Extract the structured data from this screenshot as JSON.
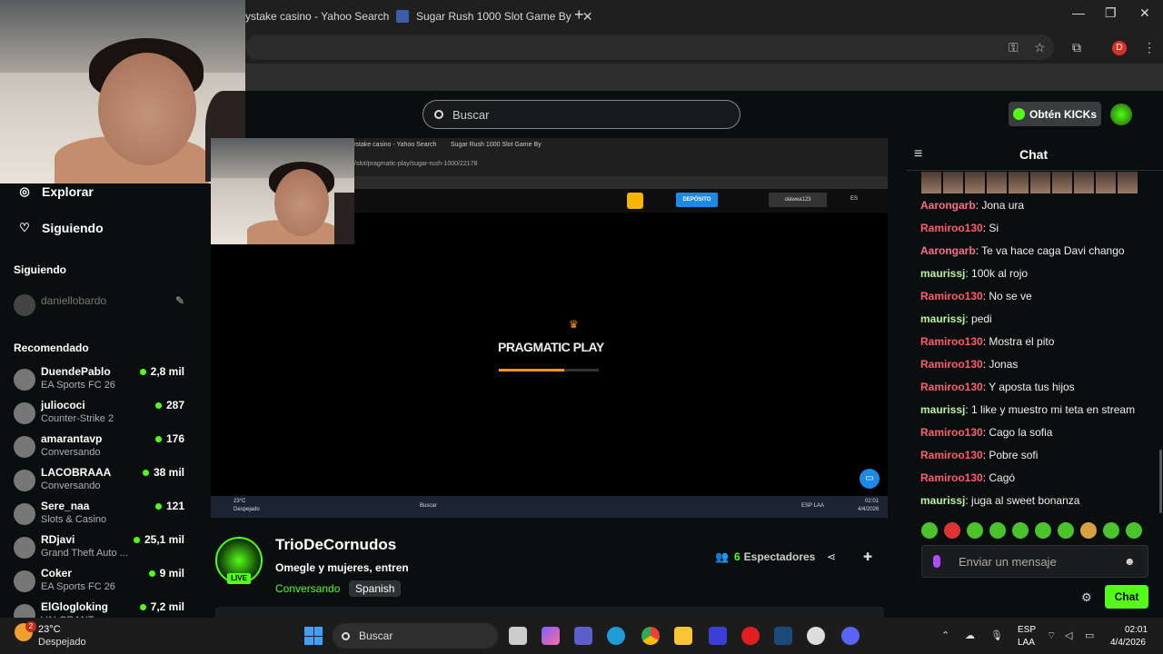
{
  "browser": {
    "tabs": [
      {
        "label": "ystake casino - Yahoo Search",
        "close": "✕"
      },
      {
        "label": "Sugar Rush 1000 Slot Game By",
        "close": "✕"
      }
    ],
    "new_tab": "+",
    "window_controls": {
      "minimize": "—",
      "maximize": "❐",
      "close": "✕"
    },
    "profile_initial": "D"
  },
  "header": {
    "search_placeholder": "Buscar",
    "get_kicks": "Obtén KICKs"
  },
  "sidebar": {
    "nav": [
      {
        "label": "Explorar",
        "icon": "compass-icon"
      },
      {
        "label": "Siguiendo",
        "icon": "heart-icon"
      }
    ],
    "following_title": "Siguiendo",
    "following": [
      {
        "name": "daniellobardo"
      }
    ],
    "recommended_title": "Recomendado",
    "recommended": [
      {
        "name": "DuendePablo",
        "category": "EA Sports FC 26",
        "viewers": "2,8 mil"
      },
      {
        "name": "juliococi",
        "category": "Counter-Strike 2",
        "viewers": "287"
      },
      {
        "name": "amarantavp",
        "category": "Conversando",
        "viewers": "176"
      },
      {
        "name": "LACOBRAAA",
        "category": "Conversando",
        "viewers": "38 mil"
      },
      {
        "name": "Sere_naa",
        "category": "Slots & Casino",
        "viewers": "121"
      },
      {
        "name": "RDjavi",
        "category": "Grand Theft Auto ...",
        "viewers": "25,1 mil"
      },
      {
        "name": "Coker",
        "category": "EA Sports FC 26",
        "viewers": "9 mil"
      },
      {
        "name": "ElGlogloking",
        "category": "VALORANT",
        "viewers": "7,2 mil"
      }
    ]
  },
  "video": {
    "inner_tabs": [
      "ystake casino - Yahoo Search",
      "Sugar Rush 1000 Slot Game By"
    ],
    "inner_url": "/slot/pragmatic-play/sugar-rush-1000/22178",
    "deposit": "DEPÓSITO",
    "inner_user": "olawea123",
    "inner_lang": "ES",
    "logo_text": "PRAGMATIC PLAY",
    "loading_progress": 0.65,
    "inner_weather_temp": "23°C",
    "inner_weather_desc": "Despejado",
    "inner_search": "Buscar",
    "inner_lang_tray": "ESP LAA",
    "inner_time": "02:01",
    "inner_date": "4/4/2026"
  },
  "stream": {
    "title": "TrioDeCornudos",
    "subtitle": "Omegle y mujeres, entren",
    "category": "Conversando",
    "tag": "Spanish",
    "live": "LIVE",
    "viewer_count": "6",
    "viewer_label": "Espectadores"
  },
  "chat": {
    "title": "Chat",
    "messages": [
      {
        "user": "Aarongarb",
        "color": "#ff6b8b",
        "text": "Jona ura"
      },
      {
        "user": "Ramiroo130",
        "color": "#ff5c6c",
        "text": "Si"
      },
      {
        "user": "Aarongarb",
        "color": "#ff6b8b",
        "text": "Te va hace caga Davi chango"
      },
      {
        "user": "maurissj",
        "color": "#b9f29a",
        "text": "100k al rojo"
      },
      {
        "user": "Ramiroo130",
        "color": "#ff5c6c",
        "text": "No se ve"
      },
      {
        "user": "maurissj",
        "color": "#b9f29a",
        "text": "pedi"
      },
      {
        "user": "Ramiroo130",
        "color": "#ff5c6c",
        "text": "Mostra el pito"
      },
      {
        "user": "Ramiroo130",
        "color": "#ff5c6c",
        "text": "Jonas"
      },
      {
        "user": "Ramiroo130",
        "color": "#ff5c6c",
        "text": "Y aposta tus hijos"
      },
      {
        "user": "maurissj",
        "color": "#b9f29a",
        "text": "1 like y muestro mi teta en stream"
      },
      {
        "user": "Ramiroo130",
        "color": "#ff5c6c",
        "text": "Cago la sofia"
      },
      {
        "user": "Ramiroo130",
        "color": "#ff5c6c",
        "text": "Pobre sofi"
      },
      {
        "user": "Ramiroo130",
        "color": "#ff5c6c",
        "text": "Cagó"
      },
      {
        "user": "maurissj",
        "color": "#b9f29a",
        "text": "juga al sweet bonanza"
      }
    ],
    "input_placeholder": "Enviar un mensaje",
    "send": "Chat"
  },
  "taskbar": {
    "weather_temp": "23°C",
    "weather_desc": "Despejado",
    "weather_badge": "2",
    "search": "Buscar",
    "lang1": "ESP",
    "lang2": "LAA",
    "time": "02:01",
    "date": "4/4/2026"
  },
  "colors": {
    "accent": "#53fc18",
    "background": "#0b0e0f"
  }
}
